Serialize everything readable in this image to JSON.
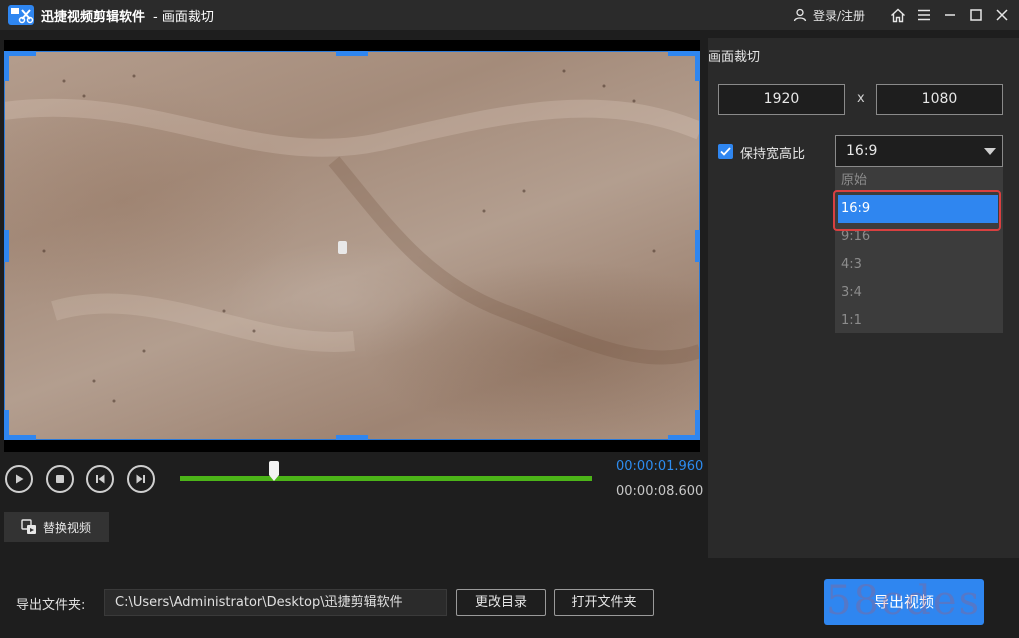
{
  "titlebar": {
    "app_name": "迅捷视频剪辑软件",
    "subtitle": "- 画面裁切",
    "login": "登录/注册"
  },
  "playback": {
    "current_time": "00:00:01.960",
    "total_time": "00:00:08.600",
    "progress": 0.228
  },
  "replace_video": "替换视频",
  "panel": {
    "title": "画面裁切",
    "width": "1920",
    "height": "1080",
    "x_sep": "x",
    "keep_ratio_label": "保持宽高比",
    "keep_ratio_checked": true,
    "ratio_selected": "16:9",
    "ratio_options": [
      "原始",
      "16:9",
      "9:16",
      "4:3",
      "3:4",
      "1:1"
    ]
  },
  "bottom": {
    "output_folder_label": "导出文件夹:",
    "output_path": "C:\\Users\\Administrator\\Desktop\\迅捷剪辑软件",
    "change_dir": "更改目录",
    "open_folder": "打开文件夹",
    "export": "导出视频"
  },
  "watermark": "58cdes",
  "colors": {
    "accent": "#2f86f0",
    "timeline": "#4cb418",
    "highlight": "#d94040"
  }
}
